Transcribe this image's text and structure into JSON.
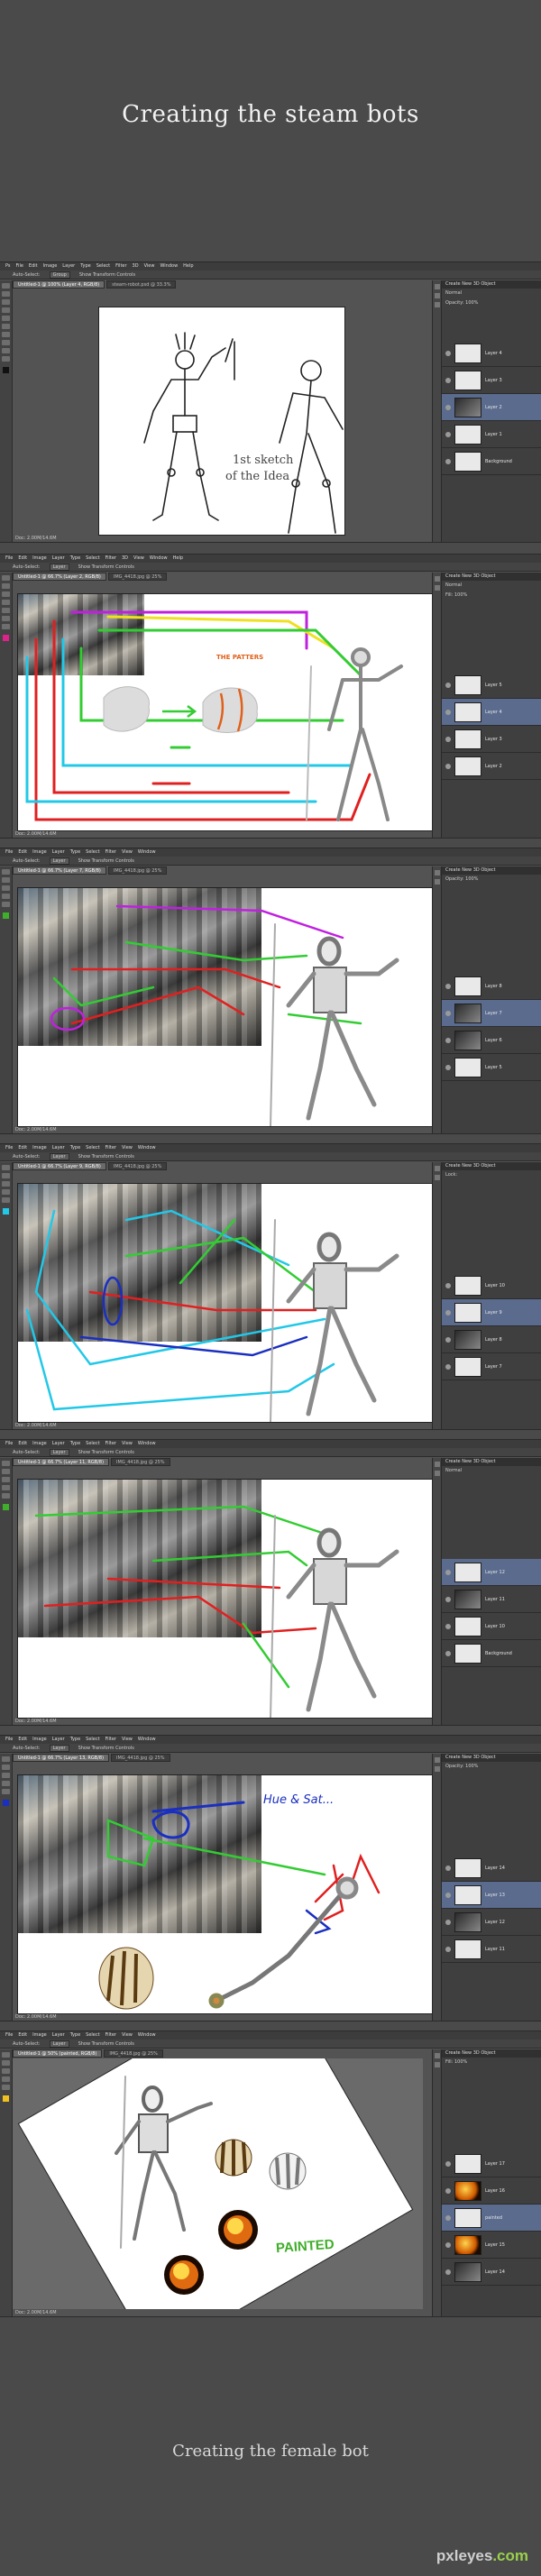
{
  "page": {
    "title": "Creating the steam bots",
    "subtitle": "Creating the female bot",
    "watermark_main": "pxleyes",
    "watermark_suffix": ".com"
  },
  "photoshop": {
    "menu": [
      "Ps",
      "File",
      "Edit",
      "Image",
      "Layer",
      "Type",
      "Select",
      "Filter",
      "3D",
      "View",
      "Window",
      "Help"
    ],
    "status_text": "Doc: 2.00M/14.6M",
    "panel_title": "Create New 3D Object",
    "panel_lines": [
      "Normal",
      "Opacity: 100%",
      "Lock:",
      "Fill: 100%"
    ]
  },
  "screens": [
    {
      "options": [
        "Auto-Select:",
        "Group",
        "Show Transform Controls"
      ],
      "tabs": [
        {
          "label": "Untitled-1 @ 100% (Layer 4, RGB/8)",
          "active": true
        },
        {
          "label": "steam-robot.psd @ 33.3%",
          "active": false
        }
      ],
      "sketch_text_1": "1st sketch",
      "sketch_text_2": "of the Idea",
      "layers": [
        "Layer 4",
        "Layer 3",
        "Layer 2",
        "Layer 1",
        "Background"
      ]
    },
    {
      "options": [
        "Auto-Select:",
        "Layer",
        "Show Transform Controls"
      ],
      "tabs": [
        {
          "label": "Untitled-1 @ 66.7% (Layer 2, RGB/8)",
          "active": true
        },
        {
          "label": "IMG_4418.jpg @ 25%",
          "active": false
        }
      ],
      "patterns_label": "THE PATTERS",
      "layers": [
        "Layer 5",
        "Layer 4",
        "Layer 3",
        "Layer 2"
      ]
    },
    {
      "options": [
        "Auto-Select:",
        "Layer",
        "Show Transform Controls"
      ],
      "tabs": [
        {
          "label": "Untitled-1 @ 66.7% (Layer 7, RGB/8)",
          "active": true
        },
        {
          "label": "IMG_4418.jpg @ 25%",
          "active": false
        }
      ],
      "layers": [
        "Layer 8",
        "Layer 7",
        "Layer 6",
        "Layer 5"
      ]
    },
    {
      "options": [
        "Auto-Select:",
        "Layer",
        "Show Transform Controls"
      ],
      "tabs": [
        {
          "label": "Untitled-1 @ 66.7% (Layer 9, RGB/8)",
          "active": true
        },
        {
          "label": "IMG_4418.jpg @ 25%",
          "active": false
        }
      ],
      "layers": [
        "Layer 10",
        "Layer 9",
        "Layer 8",
        "Layer 7"
      ]
    },
    {
      "options": [
        "Auto-Select:",
        "Layer",
        "Show Transform Controls"
      ],
      "tabs": [
        {
          "label": "Untitled-1 @ 66.7% (Layer 11, RGB/8)",
          "active": true
        },
        {
          "label": "IMG_4418.jpg @ 25%",
          "active": false
        }
      ],
      "layers": [
        "Layer 12",
        "Layer 11",
        "Layer 10",
        "Background"
      ]
    },
    {
      "options": [
        "Auto-Select:",
        "Layer",
        "Show Transform Controls"
      ],
      "tabs": [
        {
          "label": "Untitled-1 @ 66.7% (Layer 13, RGB/8)",
          "active": true
        },
        {
          "label": "IMG_4418.jpg @ 25%",
          "active": false
        }
      ],
      "hue_sat_label": "Hue & Sat...",
      "layers": [
        "Layer 14",
        "Layer 13",
        "Layer 12",
        "Layer 11"
      ]
    },
    {
      "options": [
        "Auto-Select:",
        "Layer",
        "Show Transform Controls"
      ],
      "tabs": [
        {
          "label": "Untitled-1 @ 50% (painted, RGB/8)",
          "active": true
        },
        {
          "label": "IMG_4418.jpg @ 25%",
          "active": false
        }
      ],
      "painted_label": "PAINTED",
      "layers": [
        "Layer 17",
        "Layer 16",
        "painted",
        "Layer 15",
        "Layer 14"
      ]
    }
  ],
  "colors": {
    "arrow_red": "#e02020",
    "arrow_green": "#33cc33",
    "arrow_cyan": "#22c8e8",
    "arrow_magenta": "#c020e0",
    "arrow_yellow": "#f0e020",
    "arrow_blue": "#1a2fc0",
    "painted_green": "#3fae2a",
    "patterns_orange": "#e0601a"
  }
}
